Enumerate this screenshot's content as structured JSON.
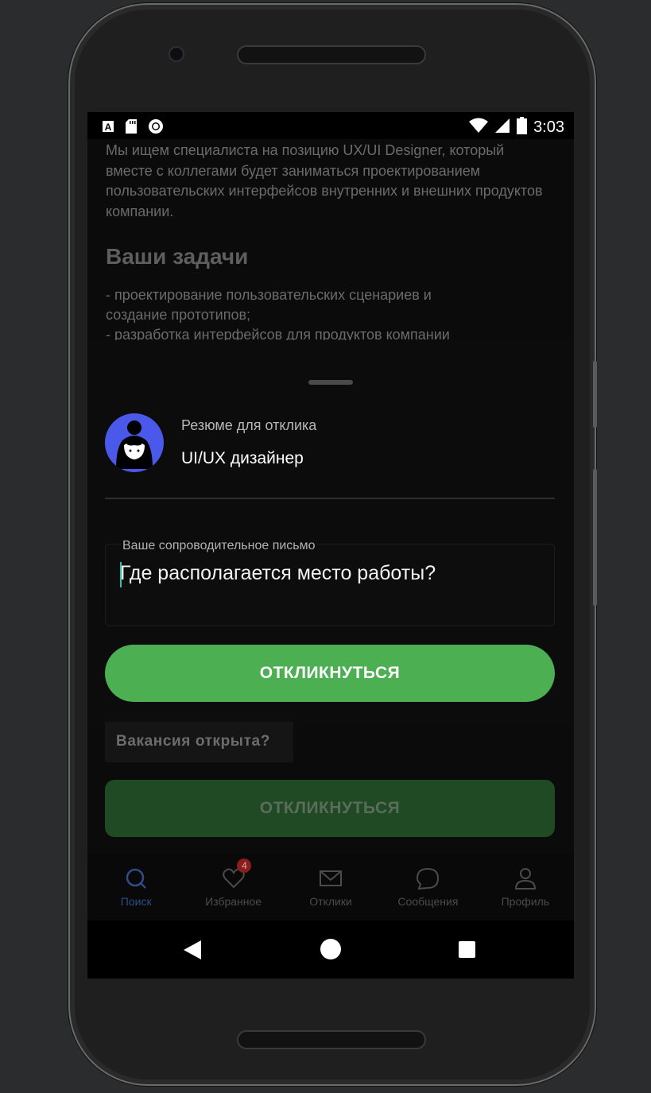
{
  "status_bar": {
    "time": "3:03",
    "left_icons": [
      "a-icon",
      "sd-card-icon",
      "record-icon"
    ],
    "right_icons": [
      "wifi-icon",
      "signal-icon",
      "battery-icon"
    ]
  },
  "background_content": {
    "intro": "Мы ищем специалиста на позицию UX/UI Designer, который вместе с коллегами будет заниматься проектированием пользовательских интерфейсов внутренних и внешних продуктов компании.",
    "section_heading": "Ваши задачи",
    "tasks_line1": "- проектирование пользовательских сценариев и",
    "tasks_line2": "создание прототипов;",
    "tasks_line3": "- разработка интерфейсов для продуктов компании"
  },
  "sheet": {
    "resume_label": "Резюме для отклика",
    "resume_title": "UI/UX дизайнер",
    "cover_letter_label": "Ваше сопроводительное письмо",
    "cover_letter_value": "Где располагается место работы?",
    "respond_button": "ОТКЛИКНУТЬСЯ"
  },
  "behind_sheet": {
    "chip_text": "Вакансия открыта?",
    "respond_button": "ОТКЛИКНУТЬСЯ"
  },
  "tabbar": {
    "tabs": [
      {
        "label": "Поиск",
        "icon": "search-icon",
        "active": true
      },
      {
        "label": "Избранное",
        "icon": "heart-icon",
        "badge": "4"
      },
      {
        "label": "Отклики",
        "icon": "mail-icon"
      },
      {
        "label": "Сообщения",
        "icon": "chat-icon"
      },
      {
        "label": "Профиль",
        "icon": "person-icon"
      }
    ]
  },
  "colors": {
    "accent_green": "#4cb052",
    "avatar_blue": "#4a59e9",
    "active_tab": "#2f4c86",
    "badge_red": "#8a1d1d"
  }
}
